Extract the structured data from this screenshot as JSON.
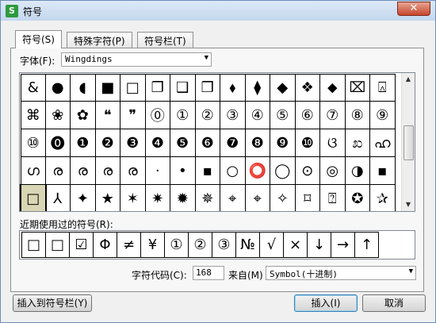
{
  "window": {
    "title": "符号",
    "app_icon": "S",
    "close_glyph": "✕"
  },
  "tabs": [
    {
      "label": "符号(S)"
    },
    {
      "label": "特殊字符(P)"
    },
    {
      "label": "符号栏(T)"
    }
  ],
  "font": {
    "label": "字体(F):",
    "value": "Wingdings"
  },
  "grid": [
    [
      "&",
      "●",
      "◖",
      "■",
      "□",
      "❐",
      "❑",
      "❒",
      "⬧",
      "⧫",
      "◆",
      "❖",
      "⬥",
      "⌧",
      "⍓"
    ],
    [
      "⌘",
      "❀",
      "✿",
      "❝",
      "❞",
      "⓪",
      "①",
      "②",
      "③",
      "④",
      "⑤",
      "⑥",
      "⑦",
      "⑧",
      "⑨"
    ],
    [
      "⑩",
      "⓿",
      "❶",
      "❷",
      "❸",
      "❹",
      "❺",
      "❻",
      "❼",
      "❽",
      "❾",
      "❿",
      "ଓ",
      "ಖ",
      "ഹ"
    ],
    [
      "ഗ",
      "ര",
      "ര",
      "ര",
      "ര",
      "·",
      "•",
      "▪",
      "○",
      "⭕",
      "◯",
      "⊙",
      "◎",
      "◑",
      "▪"
    ],
    [
      "□",
      "⅄",
      "✦",
      "★",
      "✶",
      "✷",
      "✹",
      "✵",
      "⌖",
      "⌖",
      "✧",
      "⌑",
      "⍰",
      "✪",
      "✰"
    ]
  ],
  "recent": {
    "label": "近期使用过的符号(R):",
    "items": [
      "□",
      "□",
      "☑",
      "Φ",
      "≠",
      "¥",
      "①",
      "②",
      "③",
      "№",
      "√",
      "×",
      "↓",
      "→",
      "↑"
    ]
  },
  "char_code": {
    "label": "字符代码(C):",
    "value": "168"
  },
  "from": {
    "label": "来自(M)",
    "value": "Symbol(十进制)"
  },
  "buttons": {
    "insert_to_bar": "插入到符号栏(Y)",
    "insert": "插入(I)",
    "cancel": "取消"
  },
  "icons": {
    "dropdown": "▼",
    "scroll_up": "▲",
    "scroll_down": "▼"
  }
}
